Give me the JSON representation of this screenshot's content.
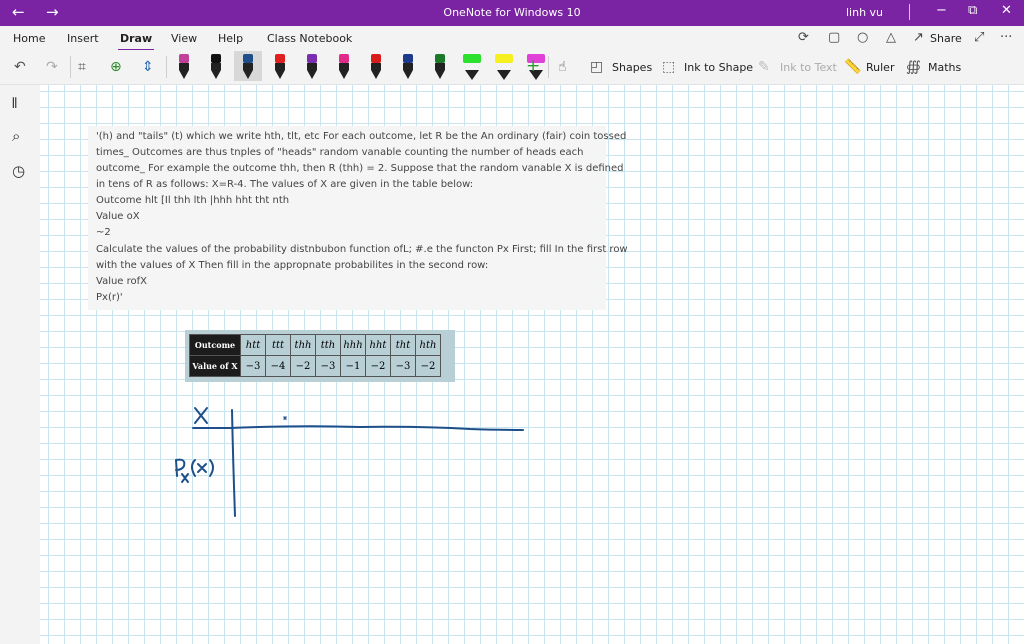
{
  "titlebar": {
    "back_icon": "←",
    "forward_icon": "→",
    "title": "OneNote for Windows 10",
    "user": "linh vu",
    "minimize": "−",
    "restore": "⧉",
    "close": "✕"
  },
  "menu": {
    "tabs": [
      "Home",
      "Insert",
      "Draw",
      "View",
      "Help",
      "Class Notebook"
    ],
    "active_tab": "Draw",
    "share_label": "Share",
    "more_label": "···"
  },
  "toolbar": {
    "shapes_label": "Shapes",
    "ink_to_shape_label": "Ink to Shape",
    "ink_to_text_label": "Ink to Text",
    "ruler_label": "Ruler",
    "maths_label": "Maths",
    "pens": [
      {
        "type": "pen",
        "color": "#c0409a"
      },
      {
        "type": "pen",
        "color": "#111111"
      },
      {
        "type": "pen",
        "color": "#1f4e8c",
        "selected": true
      },
      {
        "type": "pen",
        "color": "#e02020"
      },
      {
        "type": "pen",
        "color": "#7a2fb0"
      },
      {
        "type": "pen",
        "color": "#e02a8a"
      },
      {
        "type": "pen",
        "color": "#d81b1b"
      },
      {
        "type": "pen",
        "color": "#1b3a8c"
      },
      {
        "type": "pen",
        "color": "#1a7a2a"
      },
      {
        "type": "highlighter",
        "color": "#2ee02e"
      },
      {
        "type": "highlighter",
        "color": "#f6f020"
      },
      {
        "type": "highlighter",
        "color": "#e040d8"
      }
    ]
  },
  "textbox": {
    "lines": [
      "'(h) and \"tails\" (t) which we write hth, tlt, etc For each outcome, let R be the An ordinary (fair) coin tossed",
      "times_ Outcomes are thus tnples of \"heads\" random vanable counting the number of heads each",
      "outcome_ For example the outcome thh, then R (thh) = 2. Suppose that the random vanable X is defined",
      "in tens of R as follows: X=R-4. The values of X are given in the table below:",
      "Outcome hlt [Il thh lth |hhh hht tht nth",
      "Value oX",
      "~2",
      "Calculate the values of the probability distnbubon function ofL; #.e the functon Px First; fill In the first row",
      "with the values of X Then fill in the appropnate probabilites in the second row:",
      "Value rofX",
      "Px(r)'"
    ]
  },
  "table": {
    "row1_label": "Outcome",
    "row2_label": "Value of X",
    "outcomes": [
      "htt",
      "ttt",
      "thh",
      "tth",
      "hhh",
      "hht",
      "tht",
      "hth"
    ],
    "values": [
      "−3",
      "−4",
      "−2",
      "−3",
      "−1",
      "−2",
      "−3",
      "−2"
    ]
  },
  "handwriting": {
    "row1": "X",
    "row2": "Px(x)"
  }
}
